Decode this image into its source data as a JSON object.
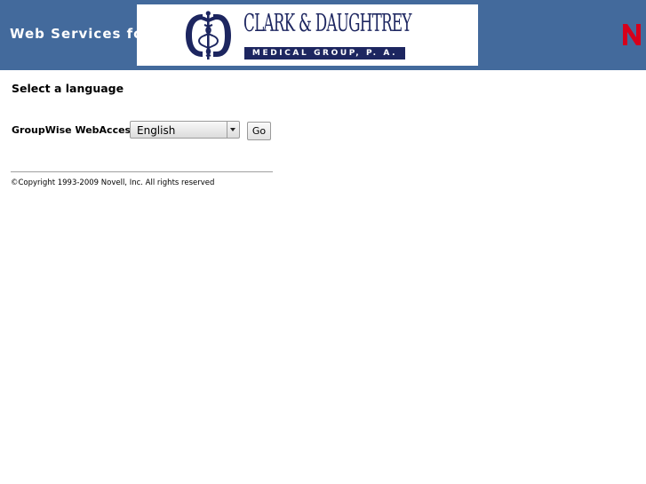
{
  "header": {
    "title": "Web Services for",
    "logo": {
      "name": "CLARK & DAUGHTREY",
      "subtitle": "MEDICAL GROUP, P. A.",
      "emblem_icon": "caduceus-icon"
    },
    "vendor_mark_icon": "novell-n-icon",
    "vendor_mark_color": "#d6001c",
    "background_color": "#436a9c"
  },
  "main": {
    "section_title": "Select a language",
    "language_selector": {
      "label": "GroupWise WebAccess:",
      "selected": "English"
    },
    "go_button_label": "Go"
  },
  "footer": {
    "copyright": "©Copyright 1993-2009 Novell, Inc. All rights reserved"
  }
}
